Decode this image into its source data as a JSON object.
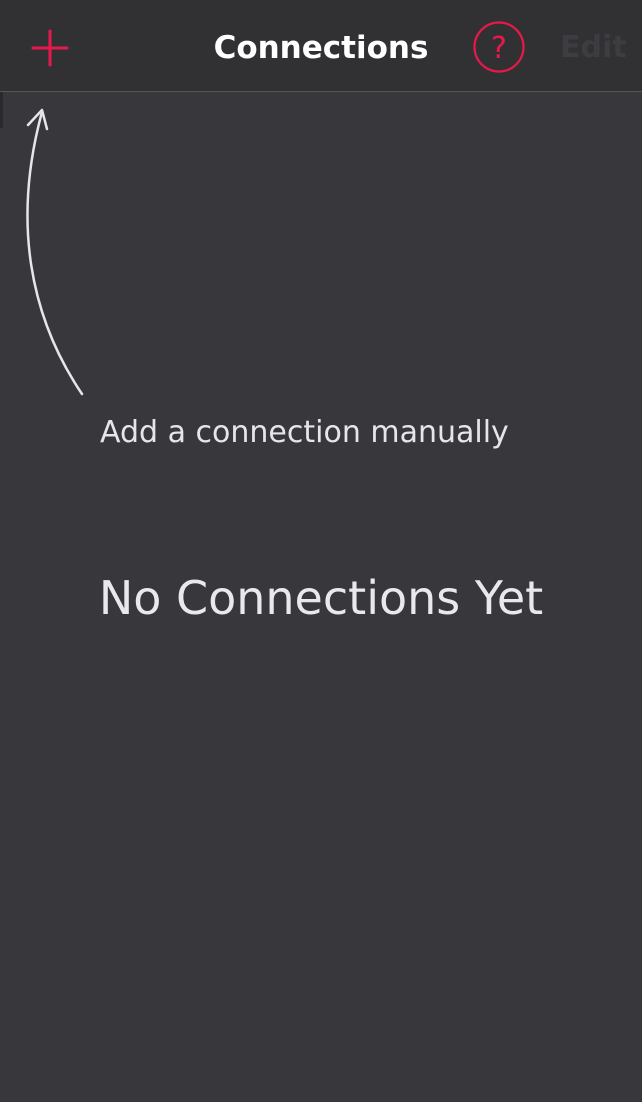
{
  "navbar": {
    "title": "Connections",
    "add_icon": "plus-icon",
    "help_icon": "question-circle-icon",
    "help_glyph": "?",
    "edit_label": "Edit",
    "accent_color": "#e8194a",
    "edit_disabled_color": "#3d3d41"
  },
  "hint": {
    "text": "Add a connection manually",
    "icon": "curved-arrow-icon"
  },
  "empty_state": {
    "title": "No Connections Yet"
  },
  "colors": {
    "background": "#38373c",
    "navbar": "#313134",
    "text": "#e6e6ea"
  }
}
